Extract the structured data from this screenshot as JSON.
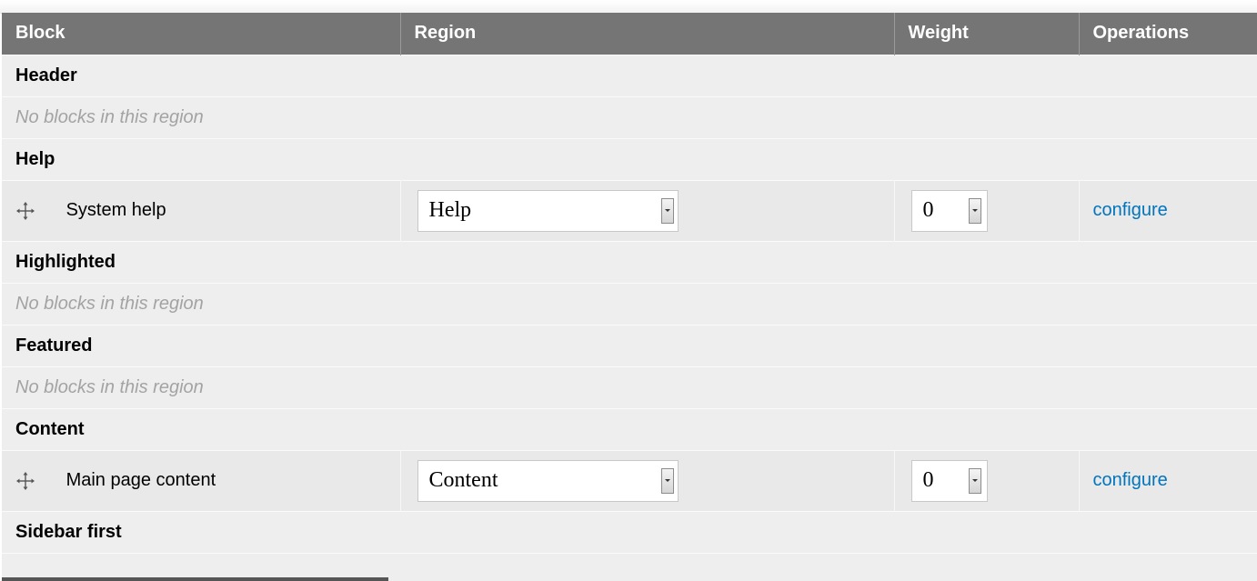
{
  "columns": {
    "block": "Block",
    "region": "Region",
    "weight": "Weight",
    "operations": "Operations"
  },
  "regions": {
    "header": {
      "title": "Header",
      "empty_text": "No blocks in this region"
    },
    "help": {
      "title": "Help",
      "block": {
        "name": "System help",
        "region_value": "Help",
        "weight_value": "0",
        "operation": "configure"
      }
    },
    "highlighted": {
      "title": "Highlighted",
      "empty_text": "No blocks in this region"
    },
    "featured": {
      "title": "Featured",
      "empty_text": "No blocks in this region"
    },
    "content": {
      "title": "Content",
      "block": {
        "name": "Main page content",
        "region_value": "Content",
        "weight_value": "0",
        "operation": "configure"
      }
    },
    "sidebar_first": {
      "title": "Sidebar first"
    }
  },
  "icons": {
    "drag_handle": "drag-handle-icon",
    "dropdown_arrow": "chevron-down-icon"
  },
  "colors": {
    "header_bg": "#757575",
    "row_bg": "#eeeeee",
    "link": "#0074bd",
    "empty_text": "#a3a3a3"
  }
}
